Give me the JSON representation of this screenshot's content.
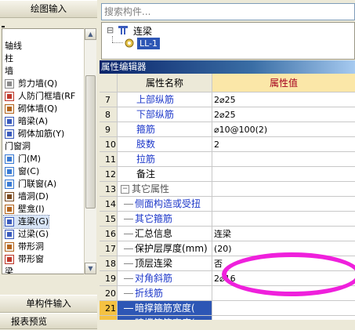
{
  "left_panel": {
    "section_title": "绘图输入",
    "bottom_section_title": "单构件输入",
    "bottom_section_title2": "报表预览",
    "tree": [
      {
        "type": "group",
        "label": "轴线"
      },
      {
        "type": "group",
        "label": "柱"
      },
      {
        "type": "group",
        "label": "墙"
      },
      {
        "type": "item",
        "label": "剪力墙(Q)",
        "icon": "shear-wall-icon"
      },
      {
        "type": "item",
        "label": "人防门框墙(RF",
        "icon": "civil-door-frame-wall-icon"
      },
      {
        "type": "item",
        "label": "砌体墙(Q)",
        "icon": "masonry-wall-icon"
      },
      {
        "type": "item",
        "label": "暗梁(A)",
        "icon": "hidden-beam-icon"
      },
      {
        "type": "item",
        "label": "砌体加筋(Y)",
        "icon": "masonry-reinforcement-icon"
      },
      {
        "type": "group",
        "label": "门窗洞"
      },
      {
        "type": "item",
        "label": "门(M)",
        "icon": "door-icon"
      },
      {
        "type": "item",
        "label": "窗(C)",
        "icon": "window-icon"
      },
      {
        "type": "item",
        "label": "门联窗(A)",
        "icon": "door-window-icon"
      },
      {
        "type": "item",
        "label": "墙洞(D)",
        "icon": "wall-hole-icon"
      },
      {
        "type": "item",
        "label": "壁龛(I)",
        "icon": "niche-icon"
      },
      {
        "type": "item",
        "label": "连梁(G)",
        "icon": "link-beam-icon",
        "selected": true
      },
      {
        "type": "item",
        "label": "过梁(G)",
        "icon": "lintel-icon"
      },
      {
        "type": "item",
        "label": "带形洞",
        "icon": "strip-hole-icon"
      },
      {
        "type": "item",
        "label": "带形窗",
        "icon": "strip-window-icon"
      },
      {
        "type": "group",
        "label": "梁"
      }
    ]
  },
  "search": {
    "placeholder": "搜索构件..."
  },
  "component_tree": {
    "root_label": "连梁",
    "child_label": "LL-1",
    "expander": "⊟"
  },
  "property_editor": {
    "title": "属性编辑器",
    "col_name": "属性名称",
    "col_value": "属性值",
    "rows": [
      {
        "num": "7",
        "name": "上部纵筋",
        "value": "2⌀25",
        "style": "blue"
      },
      {
        "num": "8",
        "name": "下部纵筋",
        "value": "2⌀25",
        "style": "blue"
      },
      {
        "num": "9",
        "name": "箍筋",
        "value": "⌀10@100(2)",
        "style": "blue"
      },
      {
        "num": "10",
        "name": "肢数",
        "value": "2",
        "style": "blue"
      },
      {
        "num": "11",
        "name": "拉筋",
        "value": "",
        "style": "blue"
      },
      {
        "num": "12",
        "name": "备注",
        "value": "",
        "style": "normal"
      },
      {
        "num": "13",
        "name": "其它属性",
        "value": "",
        "style": "group"
      },
      {
        "num": "14",
        "name": "侧面构造或受扭",
        "value": "",
        "style": "child-blue"
      },
      {
        "num": "15",
        "name": "其它箍筋",
        "value": "",
        "style": "child-blue"
      },
      {
        "num": "16",
        "name": "汇总信息",
        "value": "连梁",
        "style": "child"
      },
      {
        "num": "17",
        "name": "保护层厚度(mm)",
        "value": "(20)",
        "style": "child"
      },
      {
        "num": "18",
        "name": "顶层连梁",
        "value": "否",
        "style": "child"
      },
      {
        "num": "19",
        "name": "对角斜筋",
        "value": "2⌀16",
        "style": "child-blue"
      },
      {
        "num": "20",
        "name": "折线筋",
        "value": "",
        "style": "child-blue"
      },
      {
        "num": "21",
        "name": "暗撑箍筋宽度(",
        "value": "",
        "style": "child-active"
      },
      {
        "num": "22",
        "name": "暗撑箍筋高度(",
        "value": "",
        "style": "child-active"
      }
    ]
  },
  "annotation": {
    "color": "#ef20dc",
    "shape": "ellipse"
  }
}
